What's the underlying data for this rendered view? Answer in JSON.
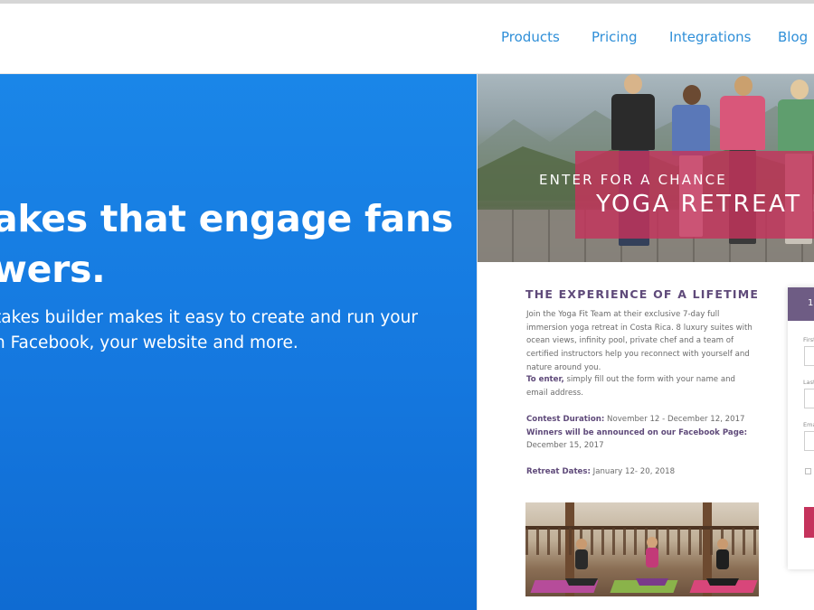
{
  "nav": {
    "items": [
      {
        "label": "Products"
      },
      {
        "label": "Pricing"
      },
      {
        "label": "Integrations"
      },
      {
        "label": "Blog"
      }
    ]
  },
  "hero": {
    "headline_line1": "akes that engage fans",
    "headline_line2": "wers.",
    "subtext_line1": "takes builder makes it easy to create and run your",
    "subtext_line2": "n Facebook, your website and more."
  },
  "preview": {
    "banner": {
      "eyebrow": "ENTER FOR A CHANCE",
      "title": "YOGA RETREAT F"
    },
    "section_title": "THE EXPERIENCE OF A LIFETIME",
    "intro": "Join the Yoga Fit Team at their exclusive 7-day full immersion yoga retreat in Costa Rica. 8 luxury suites with ocean views, infinity pool, private chef and a team of certified instructors help you reconnect with yourself and nature around you.",
    "to_enter_label": "To enter,",
    "to_enter_text": " simply fill out the form with your name and email address.",
    "duration_label": "Contest Duration:",
    "duration_value": " November 12 - December 12, 2017",
    "winners_label": "Winners will be announced on our Facebook Page:",
    "winners_value": " December 15, 2017",
    "retreat_label": "Retreat Dates:",
    "retreat_value": " January 12- 20, 2018"
  },
  "form": {
    "header_text": "1",
    "first_label": "First",
    "last_label": "Last",
    "email_label": "Ema"
  },
  "colors": {
    "nav_link": "#2f8fd8",
    "hero_blue": "#1578df",
    "banner_overlay": "#c5335c",
    "section_purple": "#5f4a7a",
    "form_header": "#6e5c84"
  }
}
